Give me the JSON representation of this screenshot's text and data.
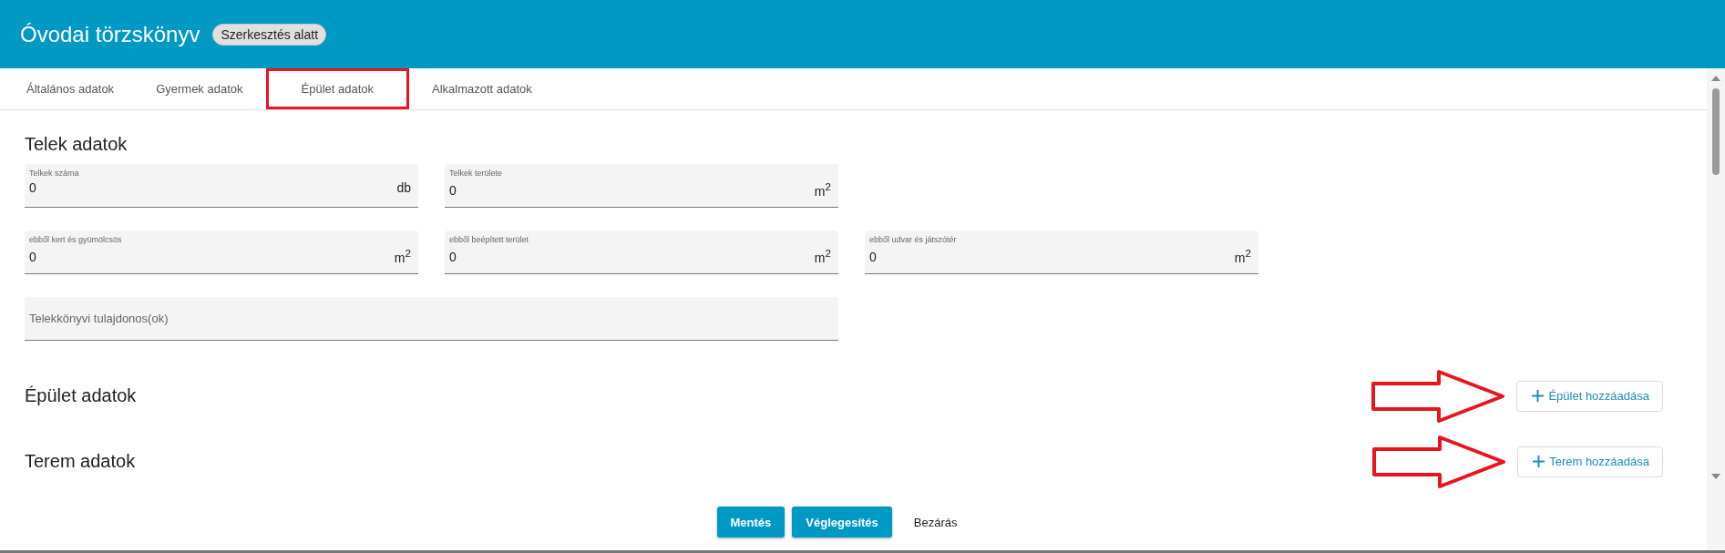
{
  "header": {
    "title": "Óvodai törzskönyv",
    "badge": "Szerkesztés alatt"
  },
  "tabs": [
    {
      "label": "Általános adatok",
      "highlighted": false
    },
    {
      "label": "Gyermek adatok",
      "highlighted": false
    },
    {
      "label": "Épület adatok",
      "highlighted": true
    },
    {
      "label": "Alkalmazott adatok",
      "highlighted": false
    }
  ],
  "plot_section": {
    "title": "Telek adatok",
    "field_rows": [
      [
        {
          "kind": "number",
          "label": "Telkek száma",
          "value": "0",
          "unit": "db"
        },
        {
          "kind": "number",
          "label": "Telkek területe",
          "value": "0",
          "unit": "m$^{2}$"
        }
      ],
      [
        {
          "kind": "number",
          "label": "ebből kert és gyümölcsös",
          "value": "0",
          "unit": "m$^{2}$"
        },
        {
          "kind": "number",
          "label": "ebből beépített terület",
          "value": "0",
          "unit": "m$^{2}$"
        },
        {
          "kind": "number",
          "label": "ebből udvar és játszótér",
          "value": "0",
          "unit": "m$^{2}$"
        }
      ],
      [
        {
          "kind": "text",
          "placeholder": "Telekkönyvi tulajdonos(ok)"
        }
      ]
    ]
  },
  "sections": [
    {
      "title": "Épület adatok",
      "button": "Épület hozzáadása",
      "highlighted": true
    },
    {
      "title": "Terem adatok",
      "button": "Terem hozzáadása",
      "highlighted": true
    }
  ],
  "footer": {
    "buttons": [
      {
        "label": "Mentés",
        "kind": "primary"
      },
      {
        "label": "Véglegesítés",
        "kind": "primary"
      },
      {
        "label": "Bezárás",
        "kind": "text"
      }
    ]
  }
}
